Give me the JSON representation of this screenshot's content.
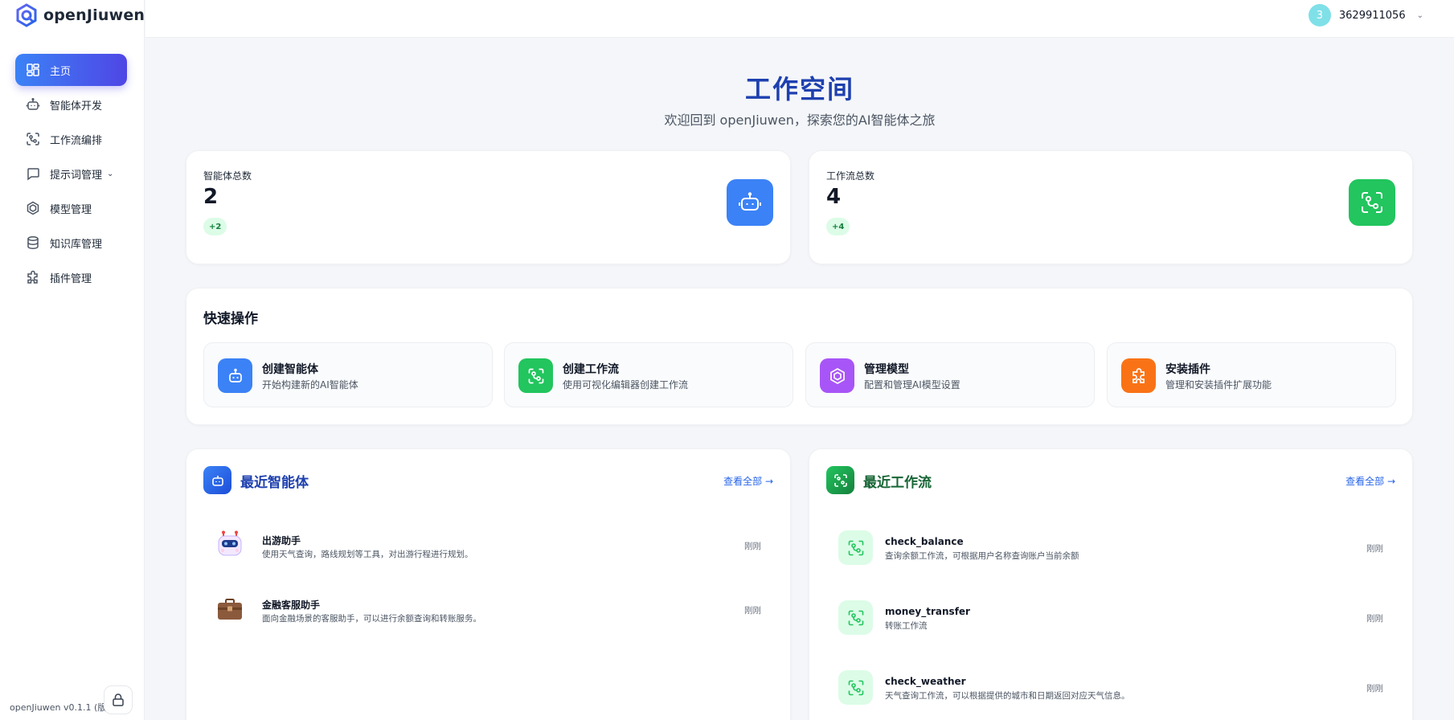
{
  "app": {
    "name": "openJiuwen",
    "version_text": "openJiuwen v0.1.1 (版本"
  },
  "sidebar": {
    "items": [
      {
        "label": "主页",
        "icon": "dashboard-icon",
        "active": true
      },
      {
        "label": "智能体开发",
        "icon": "robot-icon"
      },
      {
        "label": "工作流编排",
        "icon": "workflow-icon"
      },
      {
        "label": "提示词管理",
        "icon": "message-icon",
        "has_submenu": true
      },
      {
        "label": "模型管理",
        "icon": "model-icon"
      },
      {
        "label": "知识库管理",
        "icon": "database-icon"
      },
      {
        "label": "插件管理",
        "icon": "puzzle-icon"
      }
    ]
  },
  "header": {
    "avatar_text": "3",
    "user_name": "3629911056"
  },
  "hero": {
    "title": "工作空间",
    "subtitle": "欢迎回到 openJiuwen，探索您的AI智能体之旅"
  },
  "stats": [
    {
      "label": "智能体总数",
      "value": "2",
      "badge": "+2",
      "icon": "robot-icon",
      "color": "#3b82f6"
    },
    {
      "label": "工作流总数",
      "value": "4",
      "badge": "+4",
      "icon": "workflow-icon",
      "color": "#22c55e"
    }
  ],
  "quick": {
    "title": "快速操作",
    "items": [
      {
        "title": "创建智能体",
        "desc": "开始构建新的AI智能体",
        "icon": "robot-icon",
        "color": "#3b82f6"
      },
      {
        "title": "创建工作流",
        "desc": "使用可视化编辑器创建工作流",
        "icon": "workflow-icon",
        "color": "#22c55e"
      },
      {
        "title": "管理模型",
        "desc": "配置和管理AI模型设置",
        "icon": "model-icon",
        "color": "#a855f7"
      },
      {
        "title": "安装插件",
        "desc": "管理和安装插件扩展功能",
        "icon": "puzzle-icon",
        "color": "#f97316"
      }
    ]
  },
  "recent_agents": {
    "title": "最近智能体",
    "view_all": "查看全部 →",
    "items": [
      {
        "name": "出游助手",
        "desc": "使用天气查询，路线规划等工具，对出游行程进行规划。",
        "time": "刚刚",
        "icon": "travel-robot-icon"
      },
      {
        "name": "金融客服助手",
        "desc": "面向金融场景的客服助手，可以进行余额查询和转账服务。",
        "time": "刚刚",
        "icon": "briefcase-icon"
      }
    ]
  },
  "recent_workflows": {
    "title": "最近工作流",
    "view_all": "查看全部 →",
    "items": [
      {
        "name": "check_balance",
        "desc": "查询余额工作流，可根据用户名称查询账户当前余额",
        "time": "刚刚"
      },
      {
        "name": "money_transfer",
        "desc": "转账工作流",
        "time": "刚刚"
      },
      {
        "name": "check_weather",
        "desc": "天气查询工作流，可以根据提供的城市和日期返回对应天气信息。",
        "time": "刚刚"
      }
    ]
  },
  "colors": {
    "primary": "#3b82f6",
    "accent_indigo": "#4f46e5",
    "title_blue": "#1e40af",
    "green": "#22c55e",
    "title_green": "#166534"
  }
}
